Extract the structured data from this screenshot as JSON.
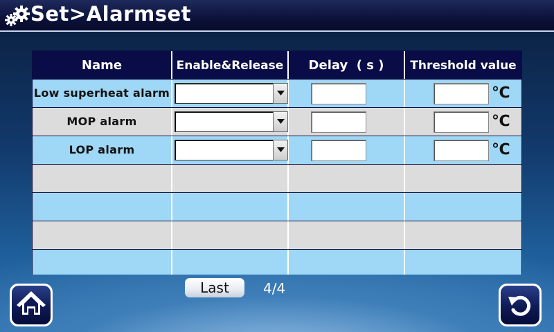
{
  "header": {
    "title": "Set>Alarmset",
    "icon": "gears-icon"
  },
  "table": {
    "columns": [
      "Name",
      "Enable&Release",
      "Delay  ( s )",
      "Threshold value"
    ],
    "rows": [
      {
        "name": "Low superheat alarm",
        "enable": "",
        "delay": "",
        "threshold": "",
        "unit": "℃"
      },
      {
        "name": "MOP alarm",
        "enable": "",
        "delay": "",
        "threshold": "",
        "unit": "℃"
      },
      {
        "name": "LOP alarm",
        "enable": "",
        "delay": "",
        "threshold": "",
        "unit": "℃"
      }
    ],
    "row_colors": {
      "blue": "#9fd7f6",
      "gray": "#dcdcdc",
      "header": "#090c46"
    }
  },
  "footer": {
    "last_label": "Last",
    "page_indicator": "4/4",
    "home_icon": "home-icon",
    "back_icon": "back-arrow-icon"
  }
}
